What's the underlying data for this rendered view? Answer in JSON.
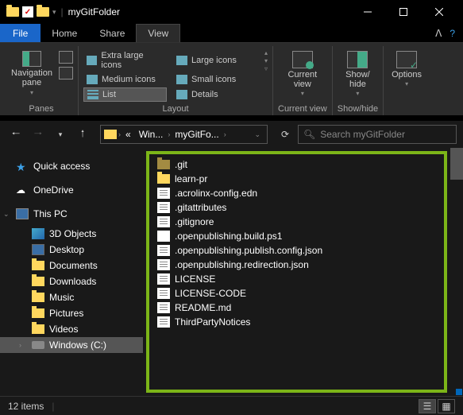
{
  "title": "myGitFolder",
  "tabs": {
    "file": "File",
    "home": "Home",
    "share": "Share",
    "view": "View"
  },
  "ribbon": {
    "panes": {
      "label": "Panes",
      "navpane": "Navigation\npane"
    },
    "layout": {
      "label": "Layout",
      "items": [
        "Extra large icons",
        "Large icons",
        "Medium icons",
        "Small icons",
        "List",
        "Details"
      ],
      "selected": "List"
    },
    "currentview": {
      "label": "Current view",
      "btn": "Current\nview"
    },
    "showhide": {
      "label": "Show/hide",
      "btn": "Show/\nhide"
    },
    "options": "Options"
  },
  "breadcrumbs": [
    "«",
    "Win...",
    "myGitFo..."
  ],
  "search_placeholder": "Search myGitFolder",
  "sidebar": {
    "quick": "Quick access",
    "onedrive": "OneDrive",
    "thispc": "This PC",
    "items": [
      "3D Objects",
      "Desktop",
      "Documents",
      "Downloads",
      "Music",
      "Pictures",
      "Videos",
      "Windows (C:)"
    ]
  },
  "files": [
    {
      "name": ".git",
      "type": "folder",
      "hidden": true
    },
    {
      "name": "learn-pr",
      "type": "folder",
      "hidden": false
    },
    {
      "name": ".acrolinx-config.edn",
      "type": "file"
    },
    {
      "name": ".gitattributes",
      "type": "file"
    },
    {
      "name": ".gitignore",
      "type": "file"
    },
    {
      "name": ".openpublishing.build.ps1",
      "type": "ps"
    },
    {
      "name": ".openpublishing.publish.config.json",
      "type": "file"
    },
    {
      "name": ".openpublishing.redirection.json",
      "type": "file"
    },
    {
      "name": "LICENSE",
      "type": "file"
    },
    {
      "name": "LICENSE-CODE",
      "type": "file"
    },
    {
      "name": "README.md",
      "type": "file"
    },
    {
      "name": "ThirdPartyNotices",
      "type": "file"
    }
  ],
  "status": {
    "count": "12 items"
  }
}
